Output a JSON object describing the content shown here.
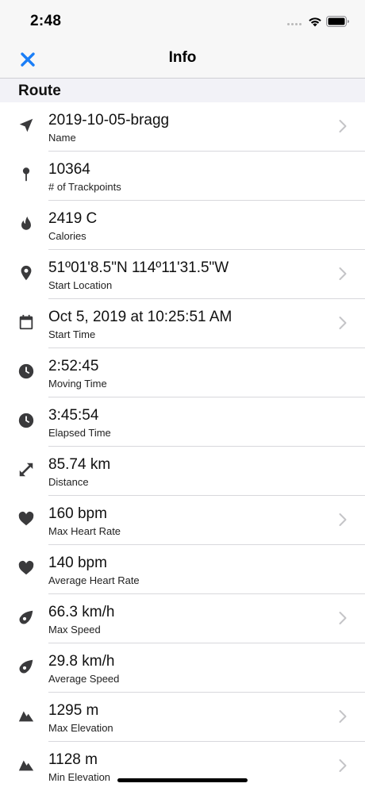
{
  "status": {
    "time": "2:48"
  },
  "nav": {
    "title": "Info"
  },
  "section": {
    "title": "Route"
  },
  "rows": [
    {
      "value": "2019-10-05-bragg",
      "label": "Name",
      "icon": "navigation-arrow-icon",
      "chevron": true
    },
    {
      "value": "10364",
      "label": "# of Trackpoints",
      "icon": "pin-icon",
      "chevron": false
    },
    {
      "value": "2419 C",
      "label": "Calories",
      "icon": "flame-icon",
      "chevron": false
    },
    {
      "value": "51º01'8.5\"N 114º11'31.5\"W",
      "label": "Start Location",
      "icon": "location-pin-icon",
      "chevron": true
    },
    {
      "value": "Oct 5, 2019 at 10:25:51 AM",
      "label": "Start Time",
      "icon": "calendar-icon",
      "chevron": true
    },
    {
      "value": "2:52:45",
      "label": "Moving Time",
      "icon": "clock-icon",
      "chevron": false
    },
    {
      "value": "3:45:54",
      "label": "Elapsed Time",
      "icon": "clock-icon",
      "chevron": false
    },
    {
      "value": "85.74 km",
      "label": "Distance",
      "icon": "expand-arrows-icon",
      "chevron": false
    },
    {
      "value": "160 bpm",
      "label": "Max Heart Rate",
      "icon": "heart-icon",
      "chevron": true
    },
    {
      "value": "140 bpm",
      "label": "Average Heart Rate",
      "icon": "heart-icon",
      "chevron": false
    },
    {
      "value": "66.3 km/h",
      "label": "Max Speed",
      "icon": "speed-icon",
      "chevron": true
    },
    {
      "value": "29.8 km/h",
      "label": "Average Speed",
      "icon": "speed-icon",
      "chevron": false
    },
    {
      "value": "1295 m",
      "label": "Max Elevation",
      "icon": "mountain-icon",
      "chevron": true
    },
    {
      "value": "1128 m",
      "label": "Min Elevation",
      "icon": "mountain-icon",
      "chevron": true
    }
  ],
  "colors": {
    "accent": "#1a7ef7",
    "icon": "#3a3a3c",
    "chevron": "#c4c4c7",
    "bar_bg": "#f7f7f7",
    "section_bg": "#f2f2f7"
  }
}
